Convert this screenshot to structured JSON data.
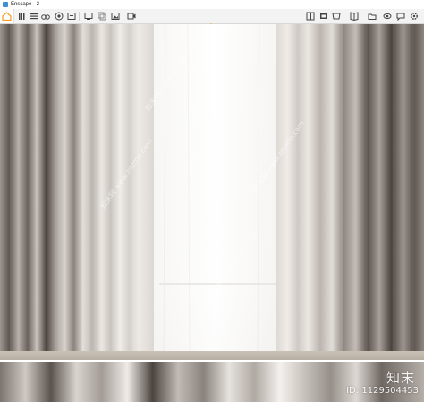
{
  "window": {
    "title": "Enscape - 2"
  },
  "toolbar": {
    "left_buttons": [
      "home-icon",
      "layers-icon",
      "list-icon",
      "binoculars-icon",
      "camera-capture-icon",
      "archive-icon",
      "monitor-icon",
      "batch-render-icon",
      "image-export-icon",
      "video-export-icon"
    ],
    "right_buttons": [
      "asset-library-icon",
      "panorama-icon",
      "material-editor-icon",
      "book-icon",
      "open-folder-icon",
      "visual-settings-icon",
      "feedback-icon",
      "settings-icon",
      "help-icon"
    ],
    "accent_color": "#f39a1e"
  },
  "watermarks": {
    "site_logo": "知末",
    "id_label": "ID: 1129504453",
    "diagonal_text": "知末网 www.znzmo.com"
  }
}
